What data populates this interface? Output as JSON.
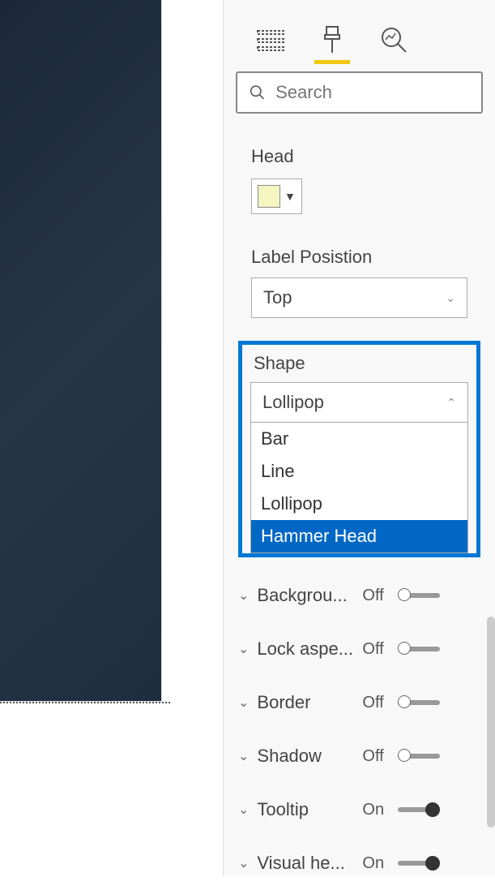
{
  "search": {
    "placeholder": "Search"
  },
  "head": {
    "label": "Head",
    "color": "#f5f5c2"
  },
  "labelPosition": {
    "label": "Label Posistion",
    "value": "Top"
  },
  "shape": {
    "label": "Shape",
    "value": "Lollipop",
    "options": [
      "Bar",
      "Line",
      "Lollipop",
      "Hammer Head"
    ],
    "hovered": "Hammer Head"
  },
  "properties": [
    {
      "label": "Backgrou...",
      "state": "Off"
    },
    {
      "label": "Lock aspe...",
      "state": "Off"
    },
    {
      "label": "Border",
      "state": "Off"
    },
    {
      "label": "Shadow",
      "state": "Off"
    },
    {
      "label": "Tooltip",
      "state": "On"
    },
    {
      "label": "Visual he...",
      "state": "On"
    }
  ]
}
